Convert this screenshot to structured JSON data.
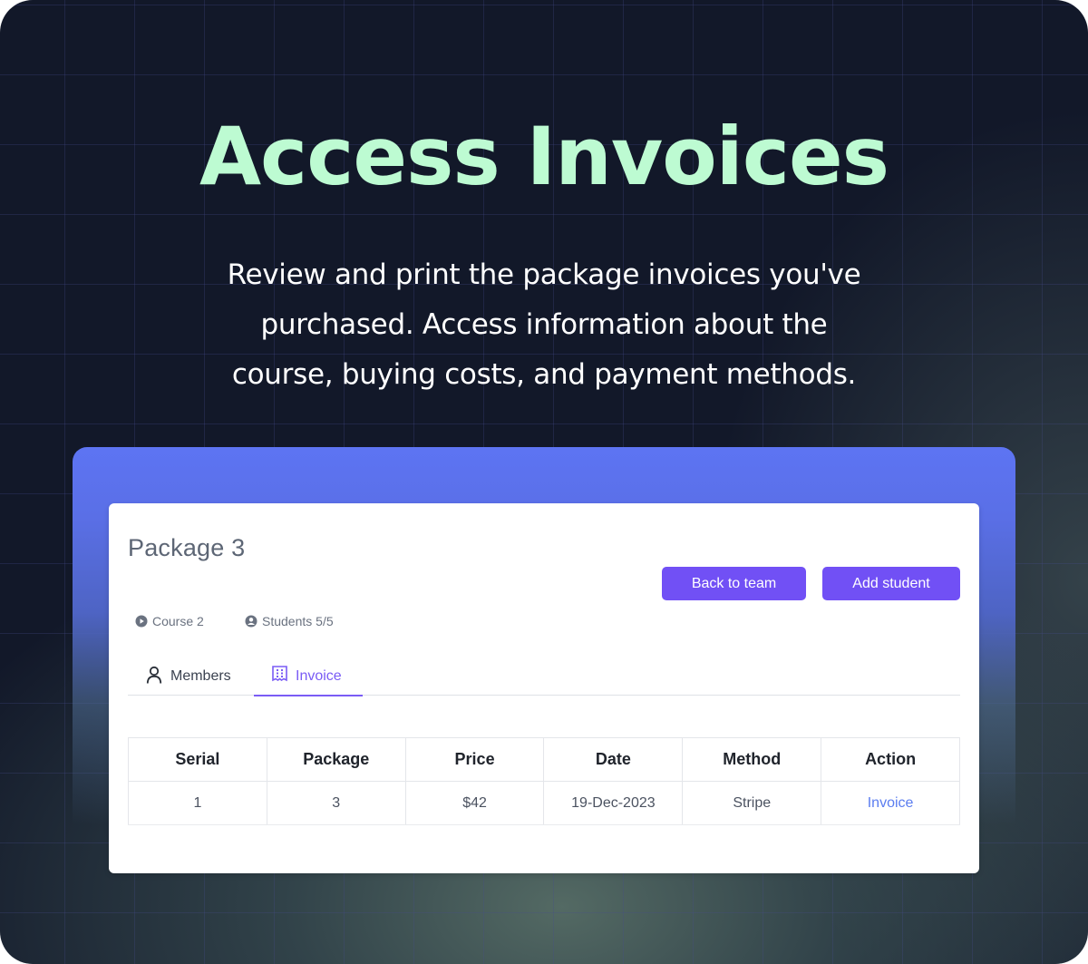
{
  "hero": {
    "title": "Access Invoices",
    "subtitle_lines": [
      "Review and print the package invoices you've",
      "purchased. Access information about the",
      "course, buying costs, and payment methods."
    ]
  },
  "colors": {
    "title_green": "#bdfbd2",
    "background": "#121829",
    "frame_blue": "#5d74f3",
    "button_purple": "#7150f5",
    "tab_active": "#7a5cf5",
    "link_blue": "#5b7df0"
  },
  "package": {
    "title": "Package 3",
    "buttons": {
      "back": "Back to team",
      "add": "Add student"
    },
    "meta": {
      "course": {
        "icon": "play-circle-icon",
        "label": "Course 2"
      },
      "students": {
        "icon": "user-circle-icon",
        "label": "Students 5/5"
      }
    },
    "tabs": [
      {
        "icon": "user-icon",
        "label": "Members",
        "active": false
      },
      {
        "icon": "invoice-icon",
        "label": "Invoice",
        "active": true
      }
    ],
    "table": {
      "columns": [
        "Serial",
        "Package",
        "Price",
        "Date",
        "Method",
        "Action"
      ],
      "rows": [
        {
          "serial": "1",
          "package": "3",
          "price": "$42",
          "date": "19-Dec-2023",
          "method": "Stripe",
          "action": "Invoice"
        }
      ]
    }
  }
}
